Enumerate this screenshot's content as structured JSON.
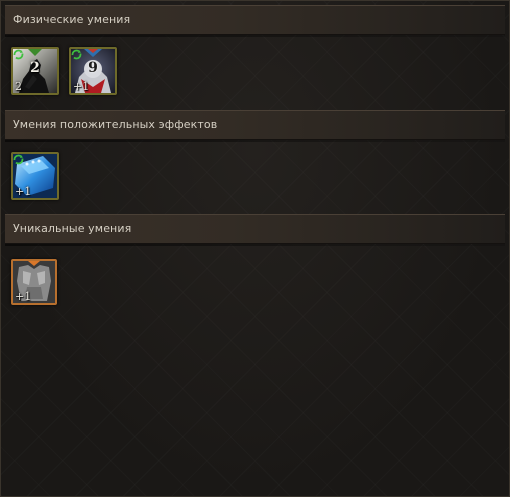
{
  "sections": [
    {
      "title": "Физические умения",
      "skills": [
        {
          "icon": "shadow-warrior-skill-icon",
          "badge": "2",
          "level": "2",
          "has_sync": true
        },
        {
          "icon": "armored-knight-skill-icon",
          "badge": "9",
          "level": "+1",
          "has_sync": true
        }
      ]
    },
    {
      "title": "Умения положительных эффектов",
      "skills": [
        {
          "icon": "blue-crystal-buff-icon",
          "level": "+1",
          "has_sync": true
        }
      ]
    },
    {
      "title": "Уникальные умения",
      "skills": [
        {
          "icon": "stone-armor-unique-icon",
          "level": "+1",
          "has_sync": false
        }
      ]
    }
  ],
  "colors": {
    "header_text": "#d6d0c4",
    "frame_gold": "#6e6a2a",
    "frame_orange": "#b8702e",
    "sync_green": "#3fbf3f"
  }
}
